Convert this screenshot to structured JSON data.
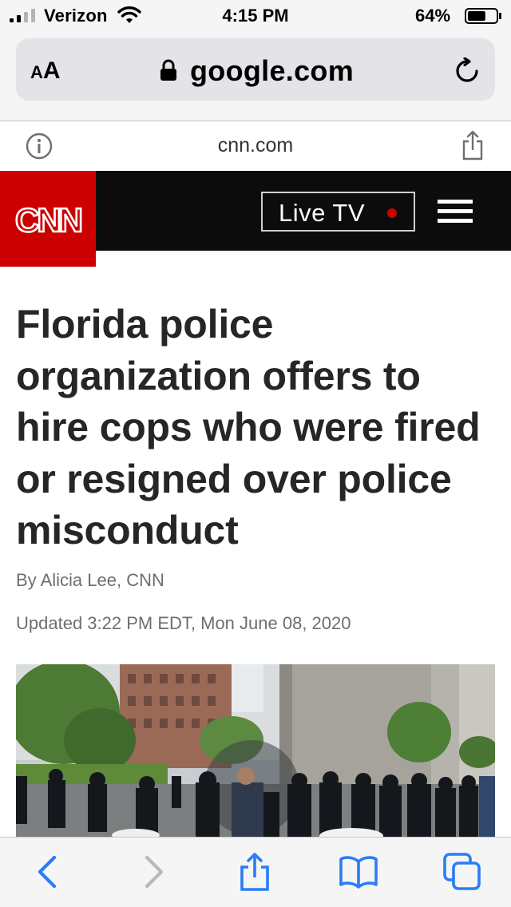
{
  "status_bar": {
    "carrier": "Verizon",
    "time": "4:15 PM",
    "battery_percent": "64%",
    "battery_level": 0.64,
    "signal_bars": 2,
    "signal_total": 4,
    "icons": [
      "signal-icon",
      "wifi-icon",
      "battery-icon"
    ]
  },
  "safari": {
    "text_size_small": "A",
    "text_size_large": "A",
    "url": "google.com",
    "domain": "cnn.com",
    "icons": [
      "lock-icon",
      "reload-icon",
      "info-icon",
      "share-icon"
    ]
  },
  "cnn_header": {
    "logo_text": "CNN",
    "live_tv_label": "Live TV",
    "brand_color": "#cc0000",
    "header_color": "#0c0c0c",
    "icons": [
      "live-indicator-dot",
      "hamburger-menu-icon"
    ]
  },
  "article": {
    "headline": "Florida police organization offers to hire cops who were fired or resigned over police misconduct",
    "byline": "By Alicia Lee, CNN",
    "timestamp": "Updated 3:22 PM EDT, Mon June 08, 2020"
  },
  "bottom_toolbar": {
    "accent_color": "#2b7cf6",
    "icons": [
      "back-icon",
      "forward-icon",
      "share-icon",
      "bookmarks-icon",
      "tabs-icon"
    ]
  }
}
